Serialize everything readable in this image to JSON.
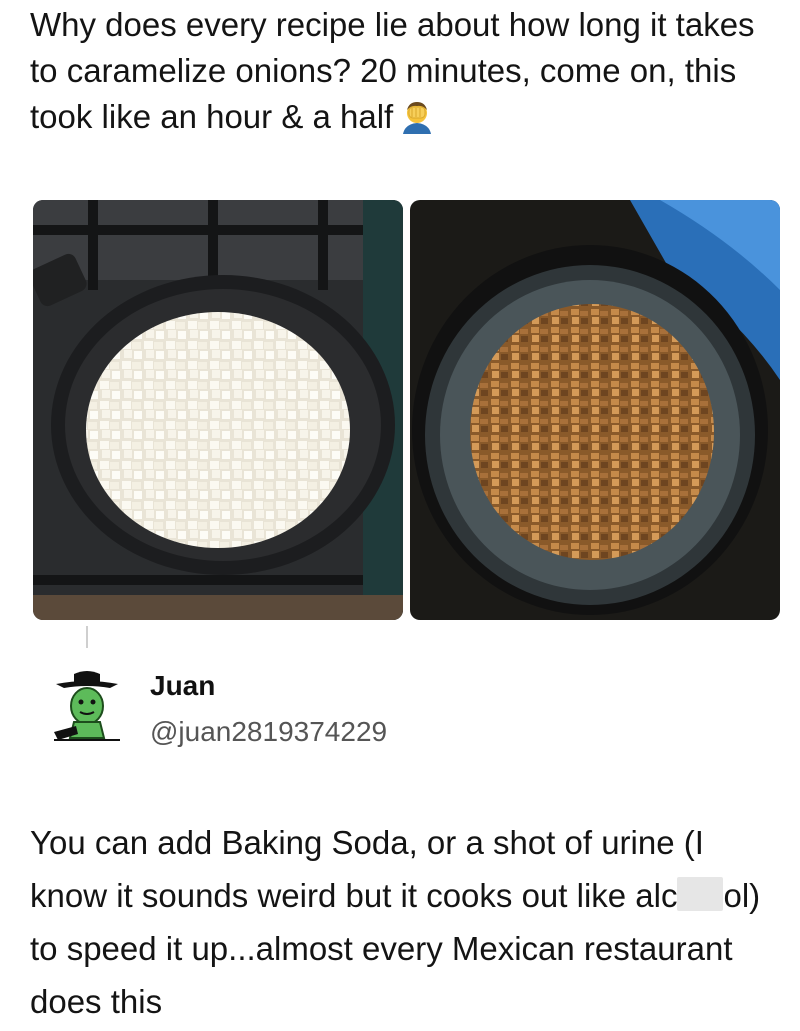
{
  "post": {
    "text": "Why does every recipe lie about how long it takes to caramelize onions? 20 minutes, come on, this took like an hour & a half",
    "emoji": "facepalm-icon"
  },
  "photos": [
    {
      "label": "raw-diced-onions-in-cast-iron-skillet"
    },
    {
      "label": "caramelized-onions-in-cast-iron-skillet"
    }
  ],
  "reply": {
    "display_name": "Juan",
    "handle": "@juan2819374229",
    "text_part1": "You can add Baking Soda, or a shot of urine (I know it sounds weird but it cooks out like alc",
    "text_part2": "ol) to speed it up...almost every Mexican restaurant does this"
  },
  "colors": {
    "background": "#ffffff",
    "text": "#141414",
    "handle": "#555555",
    "redaction": "#e6e6e6"
  }
}
